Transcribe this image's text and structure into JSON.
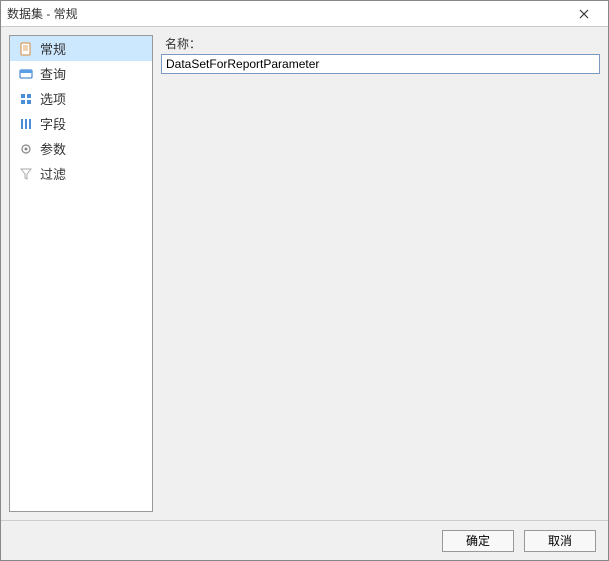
{
  "window": {
    "title": "数据集 - 常规"
  },
  "sidebar": {
    "items": [
      {
        "label": "常规",
        "icon": "document-icon",
        "selected": true
      },
      {
        "label": "查询",
        "icon": "query-icon",
        "selected": false
      },
      {
        "label": "选项",
        "icon": "options-icon",
        "selected": false
      },
      {
        "label": "字段",
        "icon": "fields-icon",
        "selected": false
      },
      {
        "label": "参数",
        "icon": "params-icon",
        "selected": false
      },
      {
        "label": "过滤",
        "icon": "filter-icon",
        "selected": false
      }
    ]
  },
  "form": {
    "name_label": "名称：",
    "name_value": "DataSetForReportParameter"
  },
  "buttons": {
    "ok": "确定",
    "cancel": "取消"
  }
}
